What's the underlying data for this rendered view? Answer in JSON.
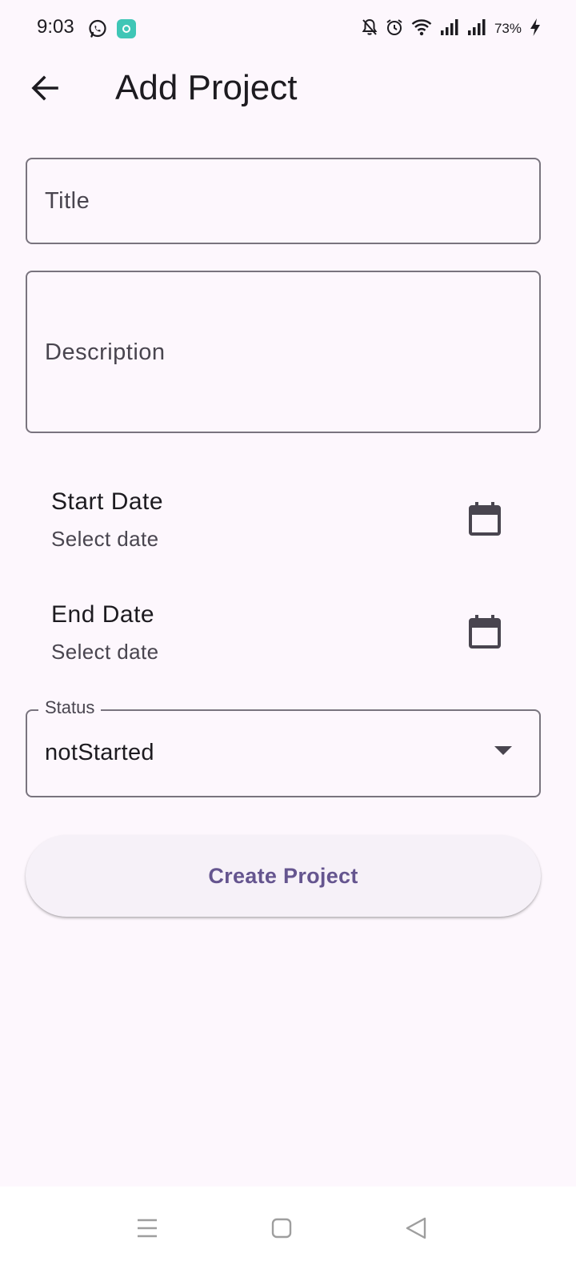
{
  "status_bar": {
    "time": "9:03",
    "battery": "73%",
    "icons": [
      "whatsapp-icon",
      "app-notification-icon",
      "bell-off-icon",
      "alarm-icon",
      "wifi-icon",
      "signal-icon",
      "signal-icon",
      "charging-icon"
    ]
  },
  "app_bar": {
    "title": "Add Project",
    "back_icon": "arrow-back-icon"
  },
  "form": {
    "title_placeholder": "Title",
    "title_value": "",
    "description_placeholder": "Description",
    "description_value": "",
    "start_date": {
      "label": "Start Date",
      "value": "Select date",
      "icon": "calendar-icon"
    },
    "end_date": {
      "label": "End Date",
      "value": "Select date",
      "icon": "calendar-icon"
    },
    "status": {
      "label": "Status",
      "value": "notStarted",
      "icon": "dropdown-arrow-icon"
    }
  },
  "actions": {
    "create_label": "Create Project"
  },
  "nav_bar": {
    "icons": [
      "menu-icon",
      "home-icon",
      "back-icon"
    ]
  },
  "colors": {
    "background": "#fdf7fd",
    "primary": "#65558f",
    "outline": "#79747e",
    "button_bg": "#f6f1f8"
  }
}
